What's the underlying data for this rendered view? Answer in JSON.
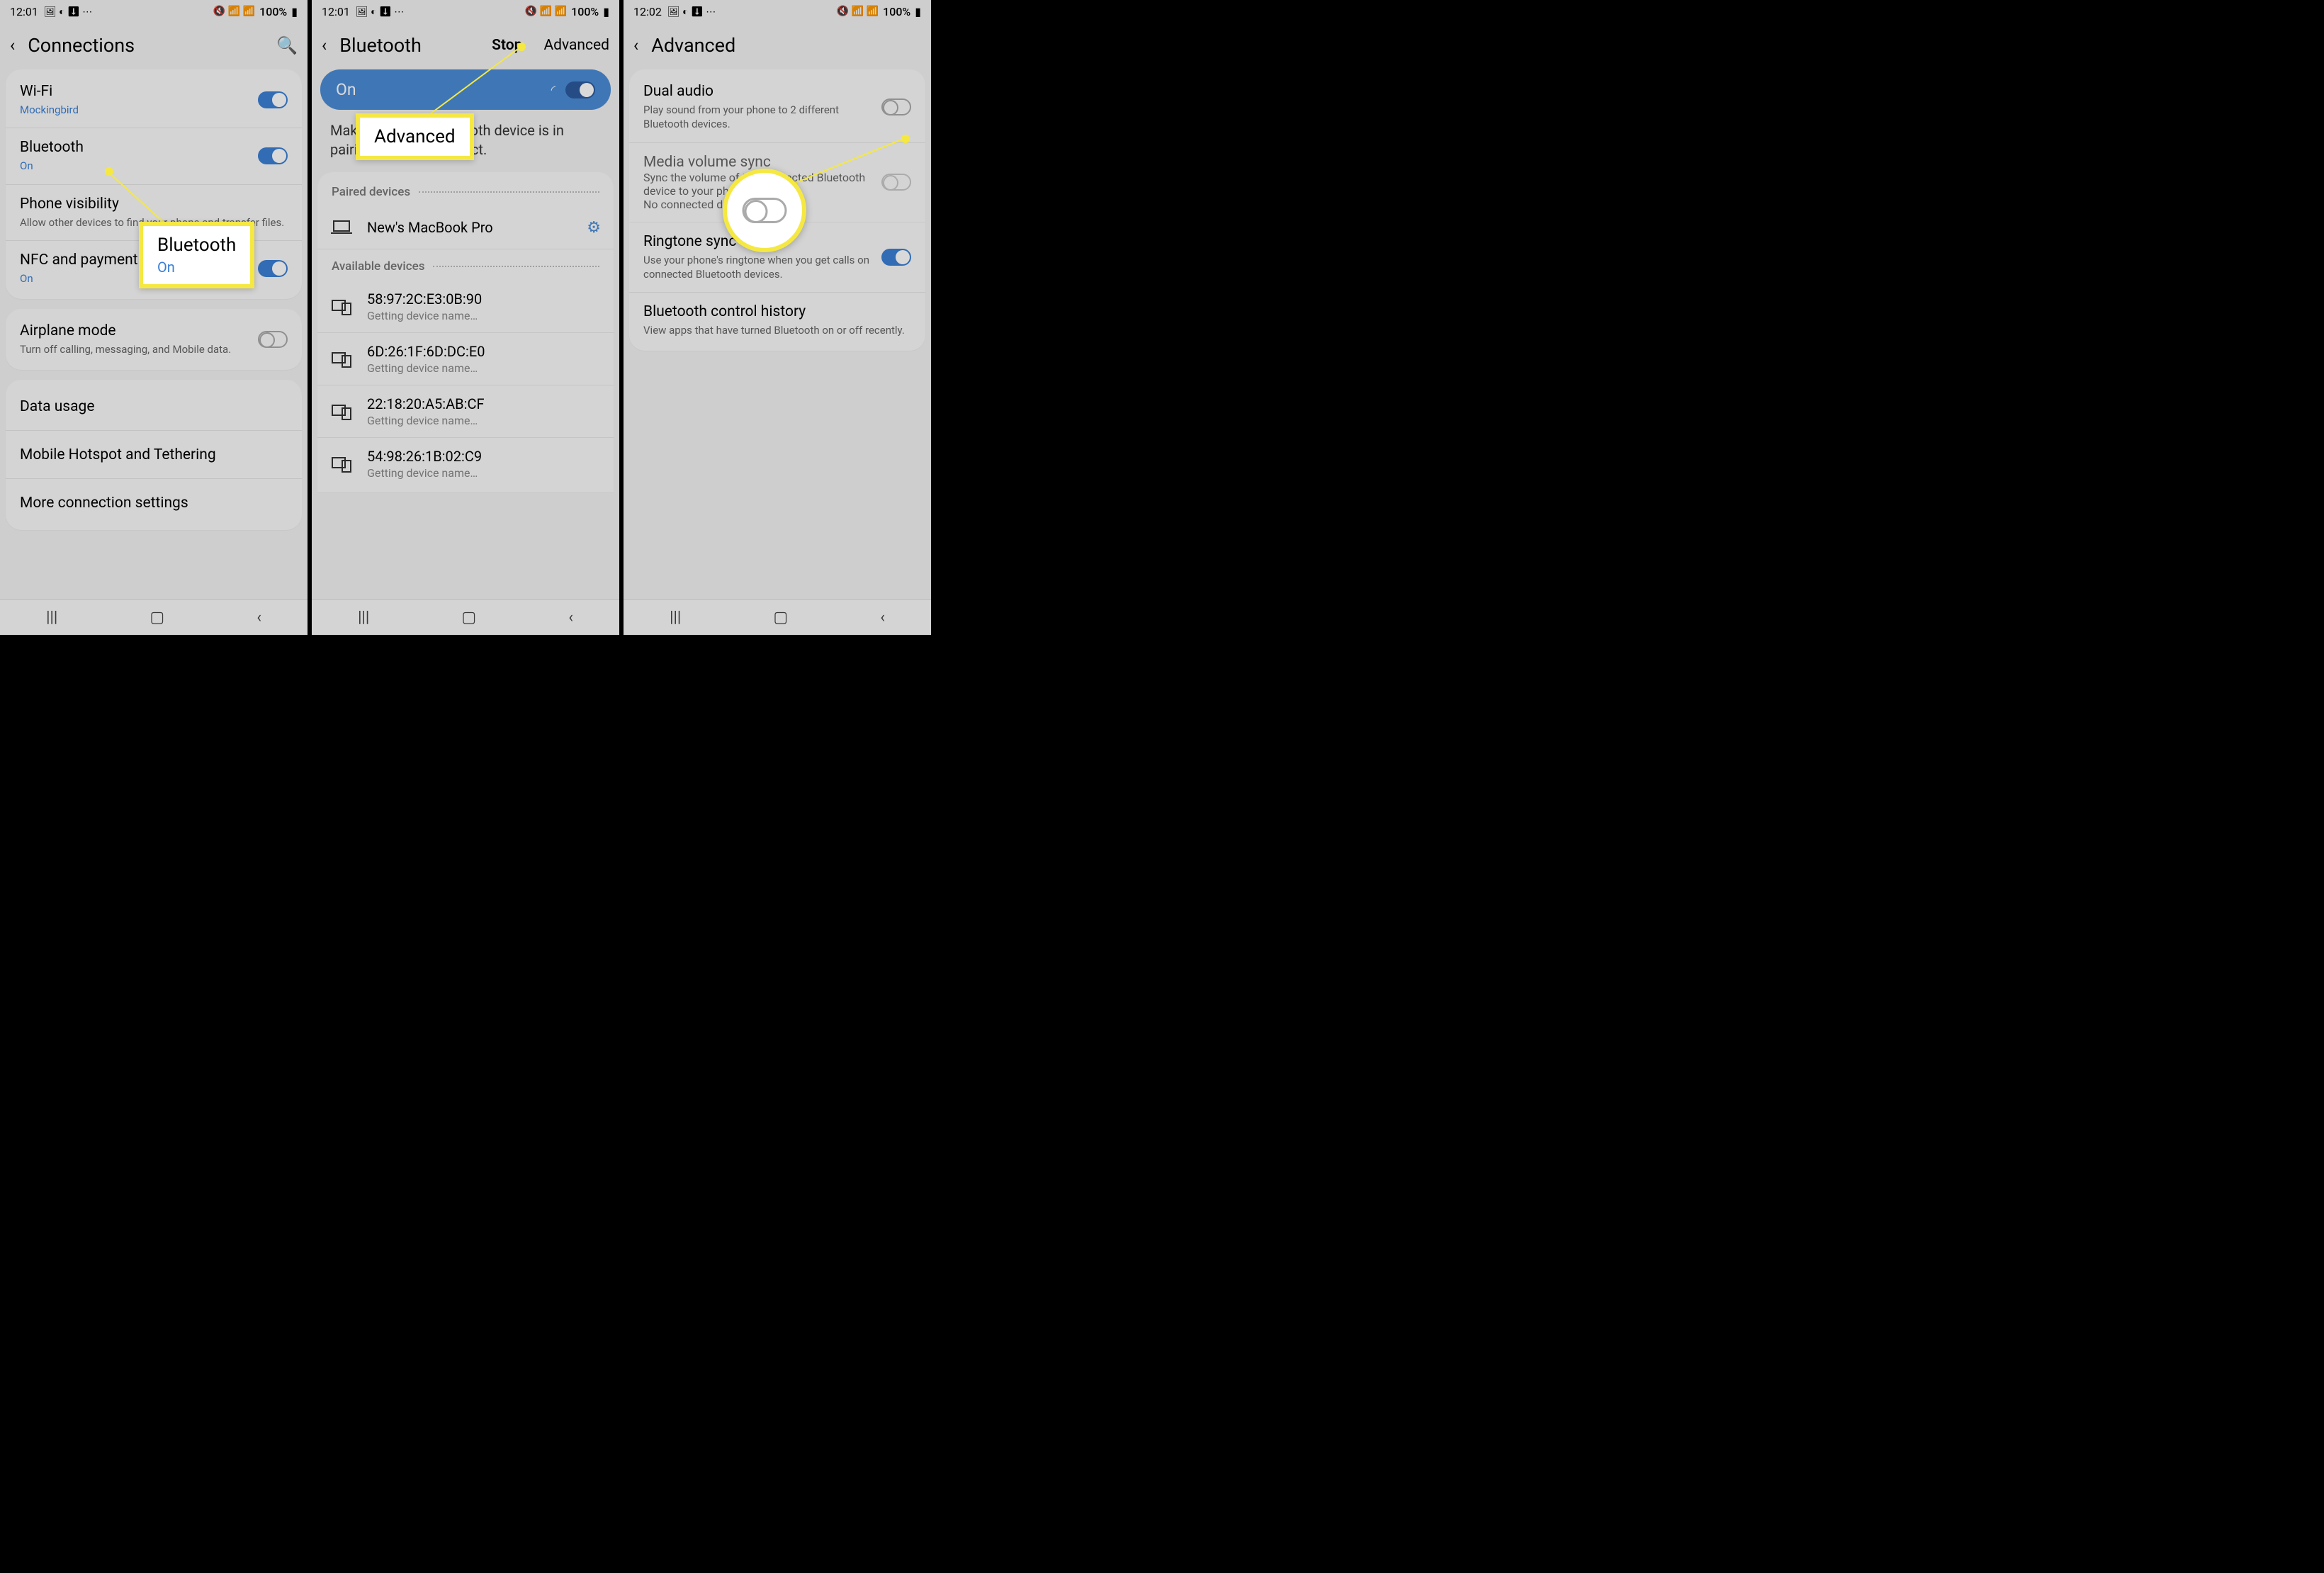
{
  "status": {
    "time1": "12:01",
    "time2": "12:01",
    "time3": "12:02",
    "icons": "🖼 ◐ ⬇ ⋯",
    "right_icons": "🔇 📶 📶",
    "battery": "100%"
  },
  "screen1": {
    "title": "Connections",
    "rows": {
      "wifi": {
        "title": "Wi-Fi",
        "sub": "Mockingbird"
      },
      "bluetooth": {
        "title": "Bluetooth",
        "sub": "On"
      },
      "visibility": {
        "title": "Phone visibility",
        "sub": "Allow other devices to find your phone and transfer files."
      },
      "nfc": {
        "title": "NFC and payment",
        "sub": "On"
      },
      "airplane": {
        "title": "Airplane mode",
        "sub": "Turn off calling, messaging, and Mobile data."
      },
      "data": {
        "title": "Data usage"
      },
      "hotspot": {
        "title": "Mobile Hotspot and Tethering"
      },
      "more": {
        "title": "More connection settings"
      }
    },
    "callout": {
      "title": "Bluetooth",
      "sub": "On"
    }
  },
  "screen2": {
    "title": "Bluetooth",
    "stop": "Stop",
    "advanced": "Advanced",
    "on": "On",
    "note": "Make sure your Bluetooth device is in pairing mode to connect.",
    "paired_header": "Paired devices",
    "available_header": "Available devices",
    "paired": [
      {
        "name": "New's MacBook Pro"
      }
    ],
    "available": [
      {
        "name": "58:97:2C:E3:0B:90",
        "sub": "Getting device name…"
      },
      {
        "name": "6D:26:1F:6D:DC:E0",
        "sub": "Getting device name…"
      },
      {
        "name": "22:18:20:A5:AB:CF",
        "sub": "Getting device name…"
      },
      {
        "name": "54:98:26:1B:02:C9",
        "sub": "Getting device name…"
      }
    ],
    "callout": "Advanced"
  },
  "screen3": {
    "title": "Advanced",
    "rows": {
      "dual": {
        "title": "Dual audio",
        "sub": "Play sound from your phone to 2 different Bluetooth devices."
      },
      "media": {
        "title": "Media volume sync",
        "sub": "Sync the volume of the connected Bluetooth device to your phone.\nNo connected devices"
      },
      "ringtone": {
        "title": "Ringtone sync",
        "sub": "Use your phone's ringtone when you get calls on connected Bluetooth devices."
      },
      "history": {
        "title": "Bluetooth control history",
        "sub": "View apps that have turned Bluetooth on or off recently."
      }
    }
  }
}
